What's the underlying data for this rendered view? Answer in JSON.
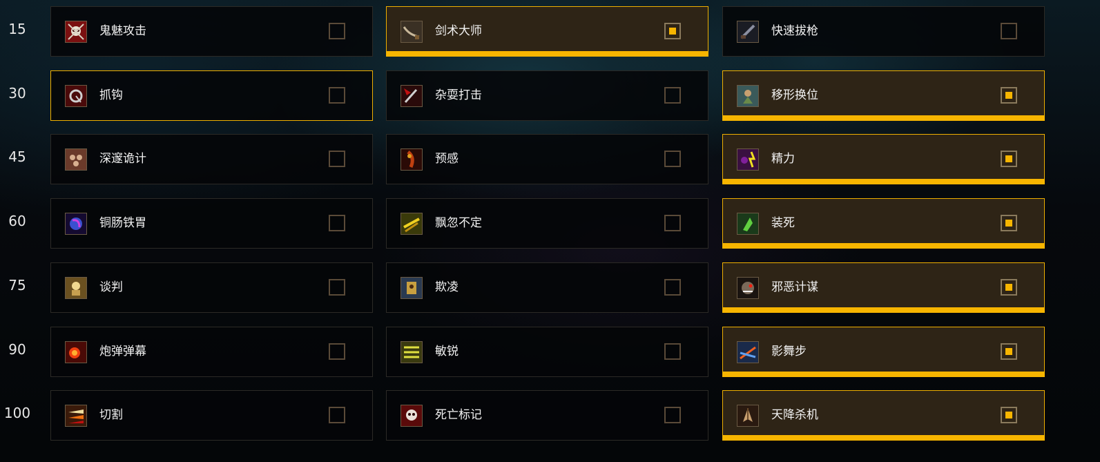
{
  "colors": {
    "accent": "#f7b500",
    "card_background": "#050608",
    "selected_background": "#2e2416",
    "checkbox_border": "#5a4a38"
  },
  "tiers": [
    {
      "level": "15",
      "talents": [
        {
          "name": "鬼魅攻击",
          "icon": "ghostly-strike-icon",
          "selected": false
        },
        {
          "name": "剑术大师",
          "icon": "swordmaster-icon",
          "selected": true
        },
        {
          "name": "快速拔枪",
          "icon": "quick-draw-icon",
          "selected": false
        }
      ]
    },
    {
      "level": "30",
      "talents": [
        {
          "name": "抓钩",
          "icon": "grappling-hook-icon",
          "selected": false,
          "hover": true
        },
        {
          "name": "杂耍打击",
          "icon": "acrobatic-strikes-icon",
          "selected": false
        },
        {
          "name": "移形换位",
          "icon": "hit-and-run-icon",
          "selected": true
        }
      ]
    },
    {
      "level": "45",
      "talents": [
        {
          "name": "深邃诡计",
          "icon": "deeper-stratagem-icon",
          "selected": false
        },
        {
          "name": "预感",
          "icon": "anticipation-icon",
          "selected": false
        },
        {
          "name": "精力",
          "icon": "vigor-icon",
          "selected": true
        }
      ]
    },
    {
      "level": "60",
      "talents": [
        {
          "name": "铜肠铁胃",
          "icon": "iron-stomach-icon",
          "selected": false
        },
        {
          "name": "飘忽不定",
          "icon": "elusiveness-icon",
          "selected": false
        },
        {
          "name": "装死",
          "icon": "cheat-death-icon",
          "selected": true
        }
      ]
    },
    {
      "level": "75",
      "talents": [
        {
          "name": "谈判",
          "icon": "parley-icon",
          "selected": false
        },
        {
          "name": "欺凌",
          "icon": "prey-on-the-weak-icon",
          "selected": false
        },
        {
          "name": "邪恶计谋",
          "icon": "dirty-tricks-icon",
          "selected": true
        }
      ]
    },
    {
      "level": "90",
      "talents": [
        {
          "name": "炮弹弹幕",
          "icon": "cannonball-barrage-icon",
          "selected": false
        },
        {
          "name": "敏锐",
          "icon": "alacrity-icon",
          "selected": false
        },
        {
          "name": "影舞步",
          "icon": "killing-spree-icon",
          "selected": true
        }
      ]
    },
    {
      "level": "100",
      "talents": [
        {
          "name": "切割",
          "icon": "slice-and-dice-icon",
          "selected": false
        },
        {
          "name": "死亡标记",
          "icon": "marked-for-death-icon",
          "selected": false
        },
        {
          "name": "天降杀机",
          "icon": "death-from-above-icon",
          "selected": true
        }
      ]
    }
  ]
}
